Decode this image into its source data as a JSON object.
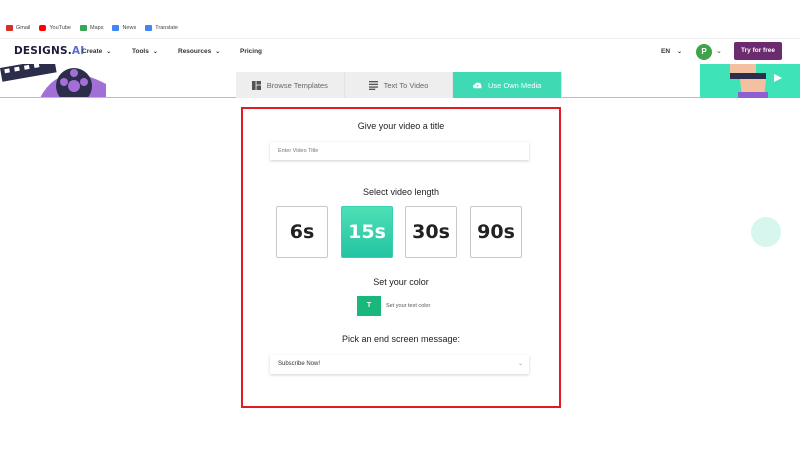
{
  "bookmarks": [
    {
      "label": "Gmail",
      "icon": "gmail-icon",
      "color": "#d93025"
    },
    {
      "label": "YouTube",
      "icon": "youtube-icon",
      "color": "#ff0000"
    },
    {
      "label": "Maps",
      "icon": "maps-icon",
      "color": "#34a853"
    },
    {
      "label": "News",
      "icon": "news-icon",
      "color": "#4285f4"
    },
    {
      "label": "Translate",
      "icon": "translate-icon",
      "color": "#4285f4"
    }
  ],
  "nav": {
    "logo_main": "DESIGNS.",
    "logo_ai": "AI",
    "items": [
      "Create",
      "Tools",
      "Resources",
      "Pricing"
    ],
    "lang": "EN",
    "avatar_initial": "P",
    "try_free": "Try for free"
  },
  "tabs": [
    {
      "label": "Browse Templates",
      "icon": "template-grid-icon",
      "active": false
    },
    {
      "label": "Text To Video",
      "icon": "text-lines-icon",
      "active": false
    },
    {
      "label": "Use Own Media",
      "icon": "cloud-upload-icon",
      "active": true
    }
  ],
  "form": {
    "title_heading": "Give your video a title",
    "title_placeholder": "Enter Video Title",
    "length_heading": "Select video length",
    "lengths": [
      "6s",
      "15s",
      "30s",
      "90s"
    ],
    "selected_length": "15s",
    "color_heading": "Set your color",
    "color_button": "T",
    "color_label": "Set your text color",
    "end_heading": "Pick an end screen message:",
    "end_value": "Subscribe Now!"
  },
  "colors": {
    "accent": "#3fd9b3",
    "brand_purple": "#6c2a6f",
    "highlight_border": "#e01b24",
    "text_color_swatch": "#19b77c"
  }
}
